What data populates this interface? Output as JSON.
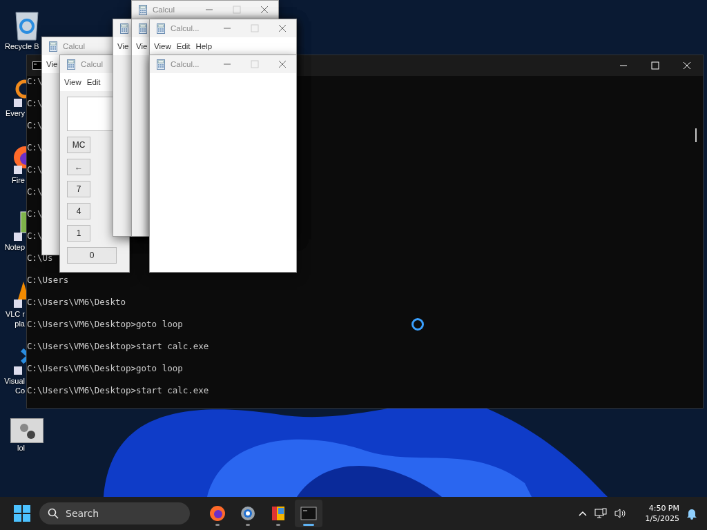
{
  "desktop_icons": [
    {
      "kind": "recycle",
      "label_lines": [
        "Recycle B"
      ]
    },
    {
      "kind": "search-app",
      "label_lines": [
        "Every"
      ]
    },
    {
      "kind": "browser",
      "label_lines": [
        "Fire"
      ]
    },
    {
      "kind": "notepad",
      "label_lines": [
        "Notep"
      ]
    },
    {
      "kind": "cone",
      "label_lines": [
        "VLC r",
        "pla"
      ]
    },
    {
      "kind": "code",
      "label_lines": [
        "Visual",
        "Co"
      ]
    },
    {
      "kind": "gears",
      "label_lines": [
        "lol"
      ]
    }
  ],
  "terminal": {
    "lines": [
      "C:\\",
      "C:\\",
      "C:\\",
      "C:\\",
      "C:\\",
      "C:\\",
      "C:\\",
      "C:\\",
      "C:\\Us",
      "C:\\Users",
      "C:\\Users\\VM6\\Deskto",
      "C:\\Users\\VM6\\Desktop>goto loop",
      "C:\\Users\\VM6\\Desktop>start calc.exe",
      "C:\\Users\\VM6\\Desktop>goto loop",
      "C:\\Users\\VM6\\Desktop>start calc.exe"
    ]
  },
  "calculator_windows": [
    {
      "title": "Calcul",
      "controls": true
    },
    {
      "title": "Calcul",
      "menu": [
        "Vie"
      ]
    },
    {
      "title": "Calcul",
      "menu": [
        "View",
        "Edit"
      ],
      "buttons": [
        "MC",
        "←",
        "7",
        "4",
        "1",
        "0"
      ]
    },
    {
      "menu": [
        "Vie"
      ]
    },
    {
      "menu": [
        "Vie"
      ]
    },
    {
      "title": "Calcul...",
      "controls": true,
      "menu": [
        "View",
        "Edit",
        "Help"
      ]
    },
    {
      "title": "Calcul...",
      "controls": true
    }
  ],
  "taskbar": {
    "search": {
      "placeholder": "Search"
    },
    "apps": [
      {
        "kind": "browser",
        "selected": false
      },
      {
        "kind": "settings",
        "selected": false
      },
      {
        "kind": "photos",
        "selected": false
      },
      {
        "kind": "terminal",
        "selected": true
      }
    ],
    "clock": {
      "time": "4:50 PM",
      "date": "1/5/2025"
    }
  }
}
